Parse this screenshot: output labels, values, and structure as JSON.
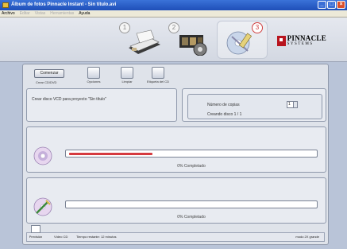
{
  "window": {
    "title": "Álbum de fotos Pinnacle Instant - Sin título.avi",
    "buttons": [
      "_",
      "□",
      "×"
    ]
  },
  "menubar": {
    "items": [
      {
        "label": "Archivo",
        "enabled": true
      },
      {
        "label": "Editar",
        "enabled": false
      },
      {
        "label": "Vistas",
        "enabled": false
      },
      {
        "label": "Herramientas",
        "enabled": false
      },
      {
        "label": "Ayuda",
        "enabled": true
      }
    ]
  },
  "steps": [
    {
      "number": "1",
      "icon": "scanner-icon"
    },
    {
      "number": "2",
      "icon": "film-editing-icon"
    },
    {
      "number": "3",
      "icon": "cd-burn-icon",
      "active": true
    }
  ],
  "logo": {
    "main": "PINNACLE",
    "sub": "SYSTEMS"
  },
  "toolbar": {
    "convert_label": "Comenzar",
    "convert_caption": "Crear CD/DVD",
    "options_label": "Opciones",
    "clean_label": "Limpiar",
    "label_cd": "Etiqueta del CD"
  },
  "info": {
    "create_text": "Crear disco VCD para proyecto \"Sin título\"",
    "copies_label": "Número de copias",
    "copies_value": "1",
    "creating_text": "Creando disco 1 / 1"
  },
  "progress": {
    "disc": {
      "fraction": 0.34,
      "label": "0% Completado"
    },
    "write": {
      "fraction": 0.0,
      "label": "0% Completado"
    }
  },
  "status": {
    "preview_label": "Previsión",
    "video_label": "Vídeo CD",
    "time_label": "Tiempo restante: 12 minutos",
    "speed_label": "modo 2X grande"
  },
  "colors": {
    "accent": "#d53a3f",
    "titlebar": "#1f4fb8"
  }
}
